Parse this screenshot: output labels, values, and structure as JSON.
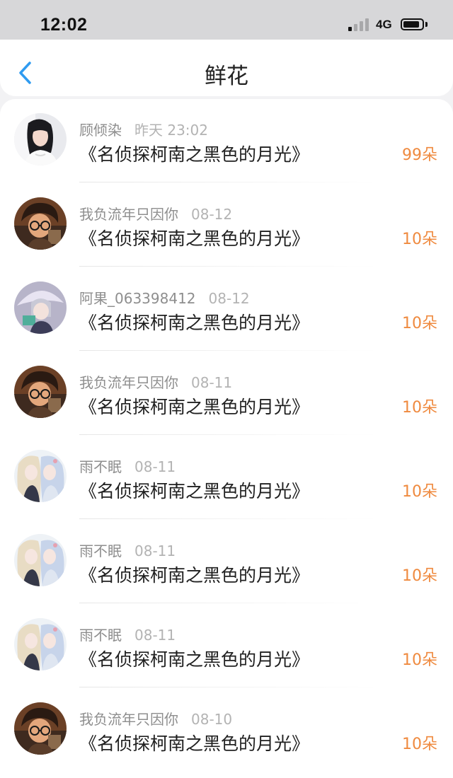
{
  "status_bar": {
    "time": "12:02",
    "network": "4G",
    "signal_bars_on": 1,
    "battery_level": 0.8
  },
  "nav": {
    "title": "鲜花",
    "back_icon": "chevron-left-icon",
    "accent_color": "#2f9bf0"
  },
  "colors": {
    "amount": "#ef8a3f",
    "text_primary": "#1f1f1f",
    "text_secondary": "#9a9a9a"
  },
  "items": [
    {
      "name": "顾倾染",
      "date": "昨天 23:02",
      "book": "《名侦探柯南之黑色的月光》",
      "amount": "99朵",
      "avatar": "girl-portrait"
    },
    {
      "name": "我负流年只因你",
      "date": "08-12",
      "book": "《名侦探柯南之黑色的月光》",
      "amount": "10朵",
      "avatar": "anime-boy-glasses"
    },
    {
      "name": "阿果_063398412",
      "date": "08-12",
      "book": "《名侦探柯南之黑色的月光》",
      "amount": "10朵",
      "avatar": "anime-girl-umbrella"
    },
    {
      "name": "我负流年只因你",
      "date": "08-11",
      "book": "《名侦探柯南之黑色的月光》",
      "amount": "10朵",
      "avatar": "anime-boy-glasses"
    },
    {
      "name": "雨不眠",
      "date": "08-11",
      "book": "《名侦探柯南之黑色的月光》",
      "amount": "10朵",
      "avatar": "anime-two-girls"
    },
    {
      "name": "雨不眠",
      "date": "08-11",
      "book": "《名侦探柯南之黑色的月光》",
      "amount": "10朵",
      "avatar": "anime-two-girls"
    },
    {
      "name": "雨不眠",
      "date": "08-11",
      "book": "《名侦探柯南之黑色的月光》",
      "amount": "10朵",
      "avatar": "anime-two-girls"
    },
    {
      "name": "我负流年只因你",
      "date": "08-10",
      "book": "《名侦探柯南之黑色的月光》",
      "amount": "10朵",
      "avatar": "anime-boy-glasses"
    }
  ]
}
